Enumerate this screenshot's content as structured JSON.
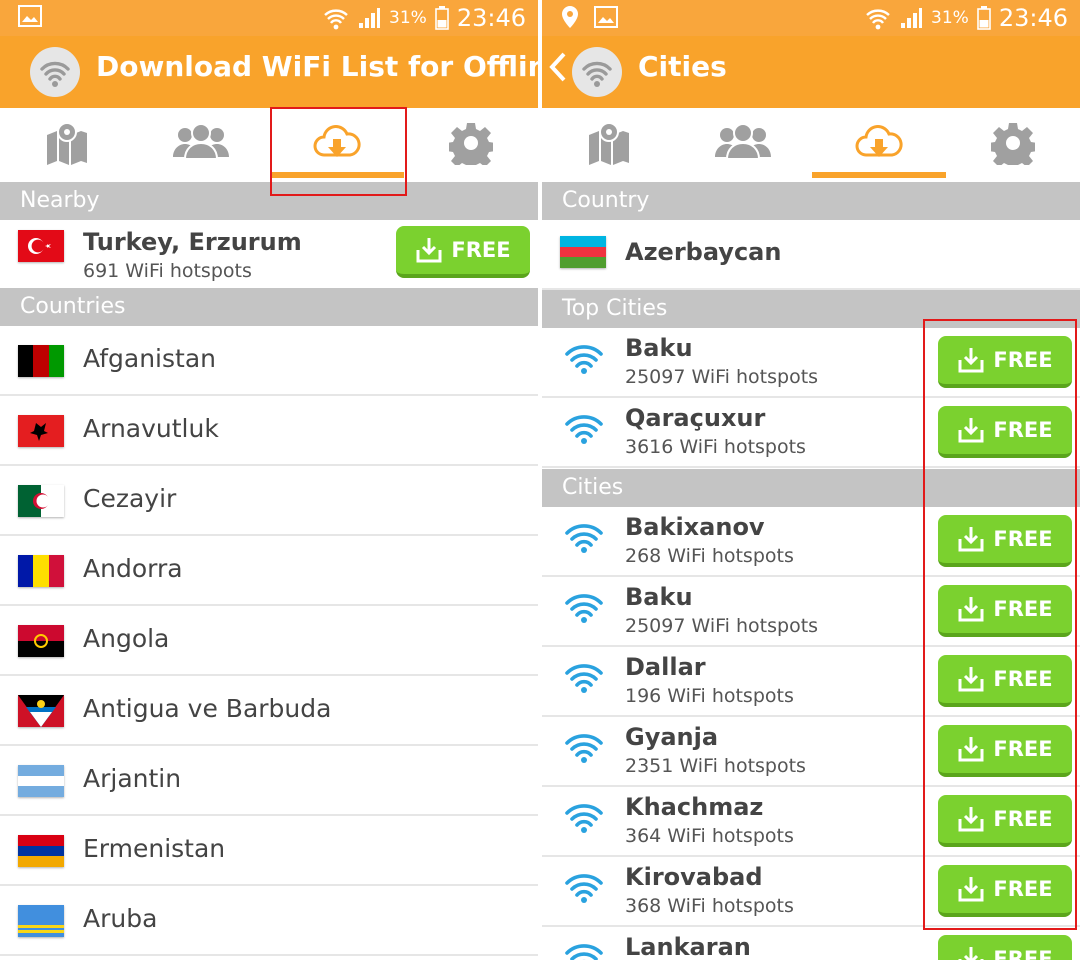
{
  "colors": {
    "accent": "#f9a32b",
    "free": "#7bd12f",
    "wifi": "#2aa2df",
    "highlight": "#e21a1a"
  },
  "left": {
    "status": {
      "battery": "31%",
      "time": "23:46"
    },
    "appbar": {
      "title": "Download WiFi List for Offline"
    },
    "tabs": [
      {
        "icon": "map-pin-icon"
      },
      {
        "icon": "users-icon"
      },
      {
        "icon": "cloud-download-icon",
        "active": true
      },
      {
        "icon": "gear-icon"
      }
    ],
    "nearby_header": "Nearby",
    "nearby": {
      "name": "Turkey, Erzurum",
      "hotspots": "691 WiFi hotspots",
      "button": "FREE"
    },
    "countries_header": "Countries",
    "countries": [
      "Afganistan",
      "Arnavutluk",
      "Cezayir",
      "Andorra",
      "Angola",
      "Antigua ve Barbuda",
      "Arjantin",
      "Ermenistan",
      "Aruba"
    ]
  },
  "right": {
    "status": {
      "battery": "31%",
      "time": "23:46"
    },
    "appbar": {
      "title": "Cities"
    },
    "tabs": [
      {
        "icon": "map-pin-icon"
      },
      {
        "icon": "users-icon"
      },
      {
        "icon": "cloud-download-icon",
        "active": true
      },
      {
        "icon": "gear-icon"
      }
    ],
    "country_header": "Country",
    "country": "Azerbaycan",
    "top_header": "Top Cities",
    "top": [
      {
        "name": "Baku",
        "hotspots": "25097 WiFi hotspots",
        "button": "FREE"
      },
      {
        "name": "Qaraçuxur",
        "hotspots": "3616 WiFi hotspots",
        "button": "FREE"
      }
    ],
    "cities_header": "Cities",
    "cities": [
      {
        "name": "Bakixanov",
        "hotspots": "268 WiFi hotspots",
        "button": "FREE"
      },
      {
        "name": "Baku",
        "hotspots": "25097 WiFi hotspots",
        "button": "FREE"
      },
      {
        "name": "Dallar",
        "hotspots": "196 WiFi hotspots",
        "button": "FREE"
      },
      {
        "name": "Gyanja",
        "hotspots": "2351 WiFi hotspots",
        "button": "FREE"
      },
      {
        "name": "Khachmaz",
        "hotspots": "364 WiFi hotspots",
        "button": "FREE"
      },
      {
        "name": "Kirovabad",
        "hotspots": "368 WiFi hotspots",
        "button": "FREE"
      },
      {
        "name": "Lankaran",
        "hotspots": "",
        "button": "FREE"
      }
    ]
  }
}
